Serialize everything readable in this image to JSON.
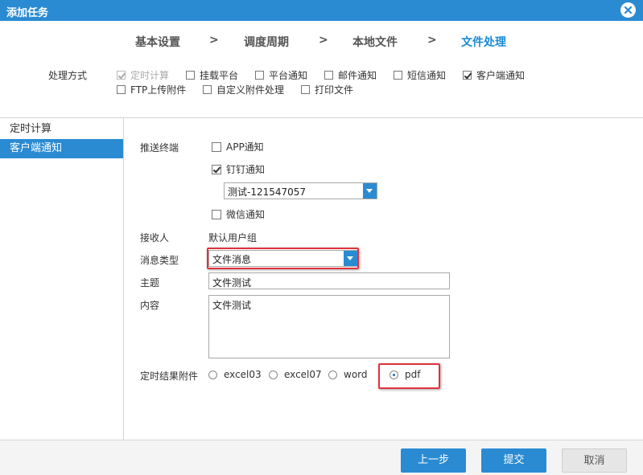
{
  "window": {
    "title": "添加任务"
  },
  "steps": [
    "基本设置",
    "调度周期",
    "本地文件",
    "文件处理"
  ],
  "step_separator": ">",
  "methods": {
    "label": "处理方式",
    "options": [
      {
        "label": "定时计算",
        "checked": true,
        "disabled": true
      },
      {
        "label": "挂载平台",
        "checked": false
      },
      {
        "label": "平台通知",
        "checked": false
      },
      {
        "label": "邮件通知",
        "checked": false
      },
      {
        "label": "短信通知",
        "checked": false
      },
      {
        "label": "客户端通知",
        "checked": true
      },
      {
        "label": "FTP上传附件",
        "checked": false
      },
      {
        "label": "自定义附件处理",
        "checked": false
      },
      {
        "label": "打印文件",
        "checked": false
      }
    ]
  },
  "nav": {
    "items": [
      "定时计算",
      "客户端通知"
    ],
    "active_index": 1
  },
  "form": {
    "push_label": "推送终端",
    "app_notify": "APP通知",
    "dingtalk_notify": "钉钉通知",
    "dingtalk_target": "测试-121547057",
    "wechat_notify": "微信通知",
    "recipient_label": "接收人",
    "recipient_value": "默认用户组",
    "msgtype_label": "消息类型",
    "msgtype_value": "文件消息",
    "subject_label": "主题",
    "subject_value": "文件测试",
    "content_label": "内容",
    "content_value": "文件测试",
    "attach_label": "定时结果附件",
    "attach_options": [
      "excel03",
      "excel07",
      "word",
      "pdf"
    ],
    "attach_selected": "pdf"
  },
  "footer": {
    "prev": "上一步",
    "submit": "提交",
    "cancel": "取消"
  },
  "colors": {
    "accent": "#2a8bd3",
    "highlight": "#e0323c"
  }
}
